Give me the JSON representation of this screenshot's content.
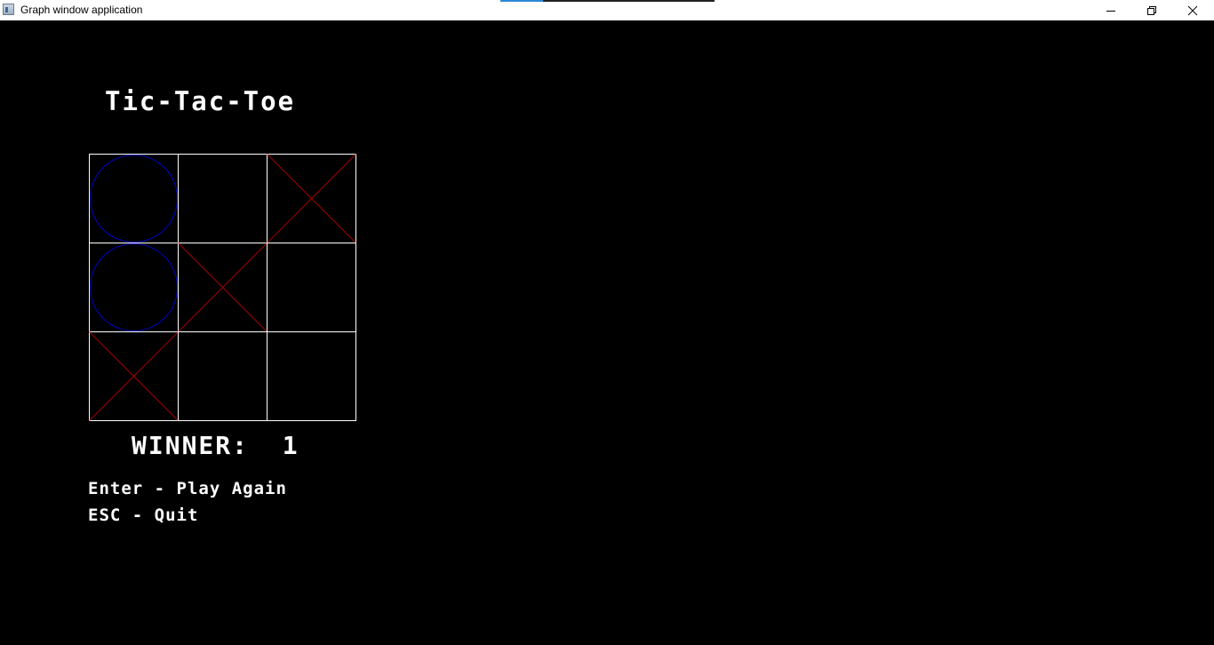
{
  "window": {
    "title": "Graph window application",
    "progress_fraction": 0.2
  },
  "game": {
    "title": "Tic-Tac-Toe",
    "board": [
      [
        "O",
        "",
        "X"
      ],
      [
        "O",
        "X",
        ""
      ],
      [
        "X",
        "",
        ""
      ]
    ],
    "winner_label": "WINNER:",
    "winner_value": "1",
    "instructions": [
      "Enter - Play Again",
      "ESC - Quit"
    ]
  },
  "colors": {
    "background": "#000000",
    "grid": "#ffffff",
    "o_mark": "#0000c8",
    "x_mark": "#a00000",
    "text": "#ffffff"
  },
  "icons": {
    "app": "graph-window-app-icon",
    "minimize": "minimize-icon",
    "maximize": "restore-icon",
    "close": "close-icon"
  }
}
